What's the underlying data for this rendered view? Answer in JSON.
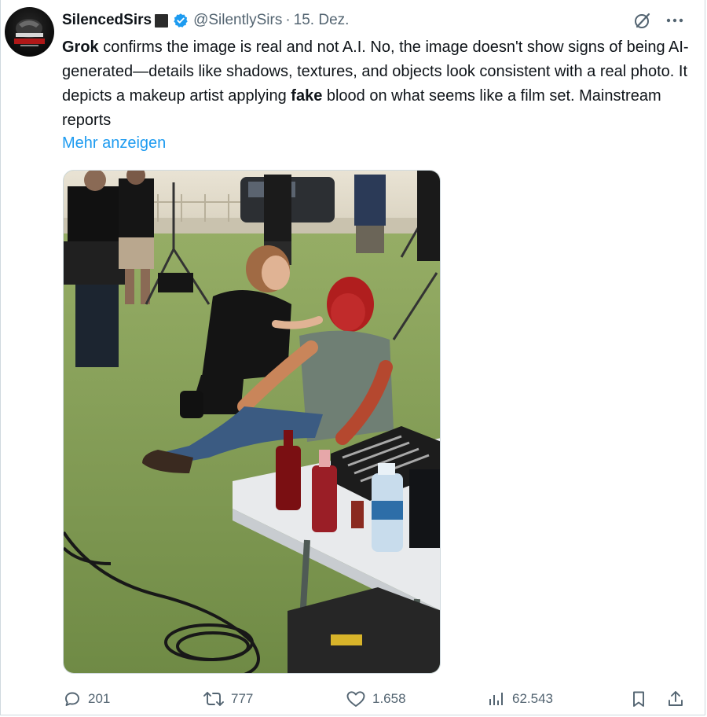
{
  "author": {
    "display_name": "SilencedSirs",
    "handle": "@SilentlySirs",
    "separator": "·",
    "date": "15. Dez."
  },
  "icons": {
    "avatar": "channel-logo-avatar",
    "badge": "dark-square-badge-icon",
    "verified": "verified-check-icon",
    "grok": "grok-icon",
    "more": "more-dots-icon",
    "reply": "reply-bubble-icon",
    "retweet": "retweet-icon",
    "like": "heart-icon",
    "views": "views-chart-icon",
    "bookmark": "bookmark-icon",
    "share": "share-icon"
  },
  "tweet": {
    "text_bold_1": "Grok",
    "text_part_1": " confirms the image is real and not A.I.  No, the image doesn't show signs of being AI-generated—details like shadows, textures, and objects look consistent with a real photo. It depicts a makeup artist applying ",
    "text_bold_2": "fake",
    "text_part_2": " blood on what seems like a film set. Mainstream reports",
    "show_more": "Mehr anzeigen"
  },
  "stats": {
    "replies": "201",
    "retweets": "777",
    "likes": "1.658",
    "views": "62.543"
  },
  "colors": {
    "link": "#1d9bf0",
    "muted": "#536471",
    "verified": "#1d9bf0",
    "text": "#0f1419"
  }
}
